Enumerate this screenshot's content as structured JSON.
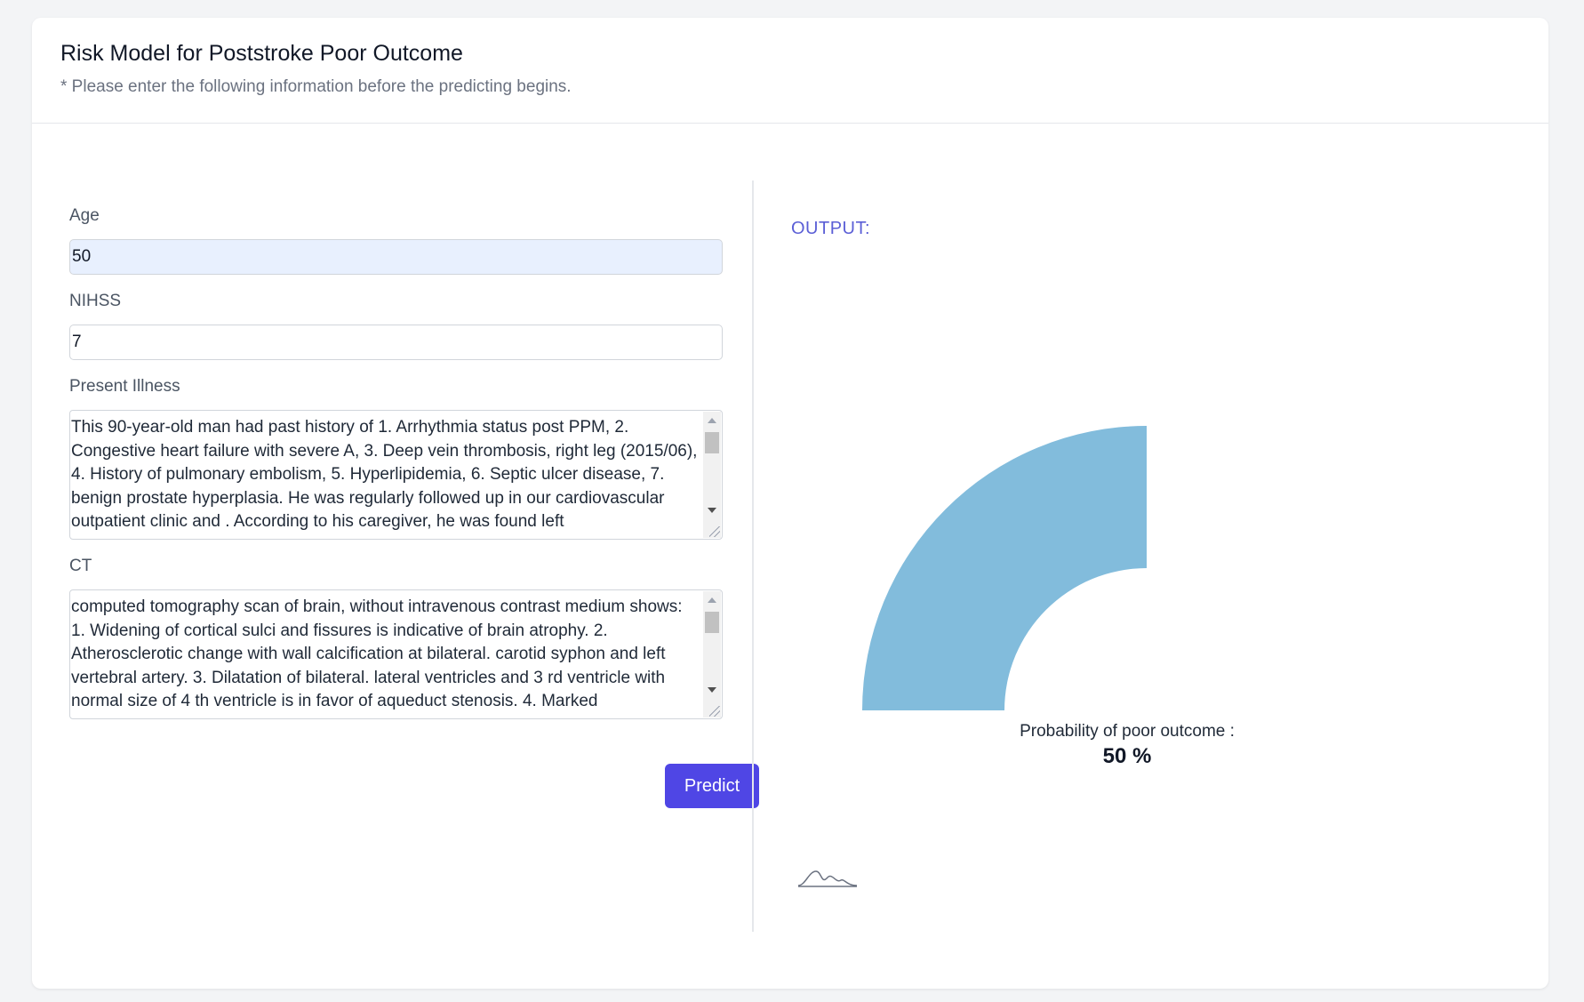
{
  "header": {
    "title": "Risk Model for Poststroke Poor Outcome",
    "subtitle": "* Please enter the following information before the predicting begins."
  },
  "form": {
    "age": {
      "label": "Age",
      "value": "50"
    },
    "nihss": {
      "label": "NIHSS",
      "value": "7"
    },
    "present_illness": {
      "label": "Present Illness",
      "value": "This 90-year-old man had past history of 1. Arrhythmia status post PPM, 2. Congestive heart failure with severe A, 3. Deep vein thrombosis, right leg (2015/06), 4. History of pulmonary embolism, 5. Hyperlipidemia, 6. Septic ulcer disease, 7. benign prostate hyperplasia. He was regularly followed up in our cardiovascular outpatient clinic and . According to his caregiver, he was found left"
    },
    "ct": {
      "label": "CT",
      "value": "computed tomography scan of brain, without intravenous contrast medium shows: 1. Widening of cortical sulci and fissures is indicative of brain atrophy. 2. Atherosclerotic change with wall calcification at bilateral. carotid syphon and left vertebral artery. 3. Dilatation of bilateral. lateral ventricles and 3 rd ventricle with normal size of 4 th ventricle is in favor of aqueduct stenosis. 4. Marked"
    },
    "predict_label": "Predict"
  },
  "output": {
    "label": "OUTPUT:",
    "probability_label": "Probability of poor outcome :",
    "probability_text": "50 %",
    "probability_value": 0.5,
    "gauge_color": "#82bcdc",
    "icon": "chart-logo-icon"
  },
  "colors": {
    "accent": "#4f46e5",
    "output_label": "#5b5fd6",
    "gauge_fill": "#82bcdc"
  }
}
